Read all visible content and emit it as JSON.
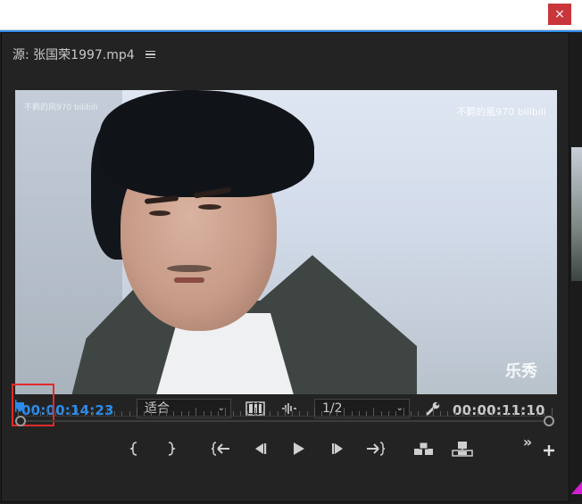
{
  "window": {
    "close_glyph": "×"
  },
  "panel": {
    "title": "源: 张国荣1997.mp4"
  },
  "video": {
    "watermark_left": "不羁的风970 bilibili",
    "watermark_right": "不羁的風970 bilibili",
    "logo": "乐秀"
  },
  "controls": {
    "current_time": "00:00:14:23",
    "zoom_value": "适合",
    "resolution_value": "1/2",
    "duration": "00:00:11:10"
  },
  "colors": {
    "accent": "#2d8ceb",
    "highlight": "#e02b2b",
    "close": "#c8363b"
  },
  "transport": {
    "buttons": [
      {
        "name": "mark-in-button",
        "glyph": "{"
      },
      {
        "name": "mark-out-button",
        "glyph": "}"
      },
      {
        "name": "go-to-in-button",
        "glyph": "{←"
      },
      {
        "name": "step-back-button",
        "glyph": "◀|"
      },
      {
        "name": "play-button",
        "glyph": "▶"
      },
      {
        "name": "step-forward-button",
        "glyph": "|▶"
      },
      {
        "name": "go-to-out-button",
        "glyph": "→}"
      },
      {
        "name": "insert-button",
        "glyph": "insert"
      },
      {
        "name": "overwrite-button",
        "glyph": "overwrite"
      },
      {
        "name": "more-controls-button",
        "glyph": "»"
      },
      {
        "name": "add-button",
        "glyph": "+"
      }
    ]
  }
}
